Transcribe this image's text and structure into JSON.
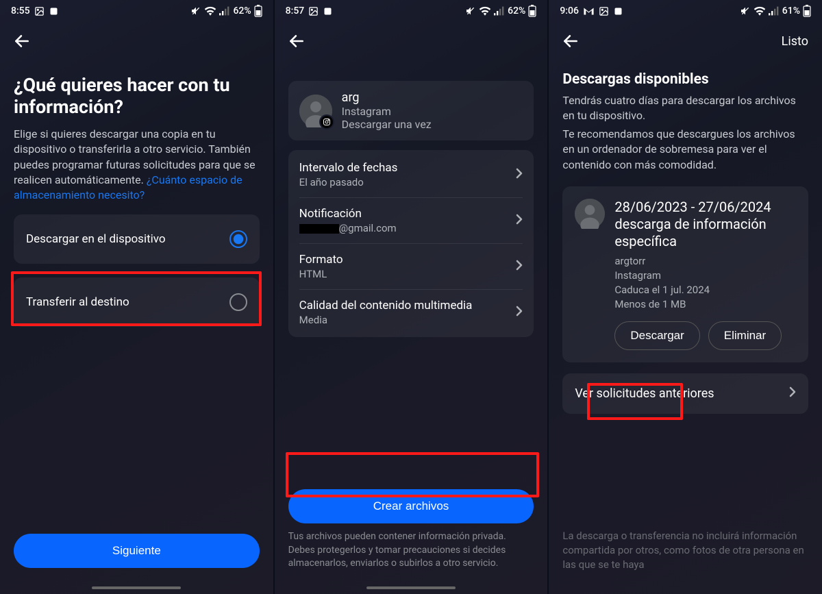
{
  "screen1": {
    "status": {
      "time": "8:55",
      "battery": "62%"
    },
    "title": "¿Qué quieres hacer con tu información?",
    "description_pre": "Elige si quieres descargar una copia en tu dispositivo o transferirla a otro servicio. También puedes programar futuras solicitudes para que se realicen automáticamente. ",
    "description_link": "¿Cuánto espacio de almacenamiento necesito?",
    "option_download": "Descargar en el dispositivo",
    "option_transfer": "Transferir al destino",
    "next_button": "Siguiente"
  },
  "screen2": {
    "status": {
      "time": "8:57",
      "battery": "62%"
    },
    "profile": {
      "name": "arg",
      "platform": "Instagram",
      "mode": "Descargar una vez"
    },
    "opts": {
      "date_range": {
        "label": "Intervalo de fechas",
        "value": "El año pasado"
      },
      "notification": {
        "label": "Notificación",
        "value_suffix": "@gmail.com"
      },
      "format": {
        "label": "Formato",
        "value": "HTML"
      },
      "quality": {
        "label": "Calidad del contenido multimedia",
        "value": "Media"
      }
    },
    "create_button": "Crear archivos",
    "footer_note": "Tus archivos pueden contener información privada. Debes protegerlos y tomar precauciones si decides almacenarlos, enviarlos o subirlos a otro servicio."
  },
  "screen3": {
    "status": {
      "time": "9:06",
      "battery": "61%"
    },
    "header_action": "Listo",
    "title": "Descargas disponibles",
    "desc_line1": "Tendrás cuatro días para descargar los archivos en tu dispositivo.",
    "desc_line2": "Te recomendamos que descargues los archivos en un ordenador de sobremesa para ver el contenido con más comodidad.",
    "download": {
      "title": "28/06/2023 - 27/06/2024 descarga de información específica",
      "username": "argtorr",
      "platform": "Instagram",
      "expires": "Caduca el 1 jul. 2024",
      "size": "Menos de 1 MB",
      "download_btn": "Descargar",
      "delete_btn": "Eliminar"
    },
    "previous_requests": "Ver solicitudes anteriores",
    "bottom_note": "La descarga o transferencia no incluirá información compartida por otros, como fotos de otra persona en las que se te haya"
  }
}
